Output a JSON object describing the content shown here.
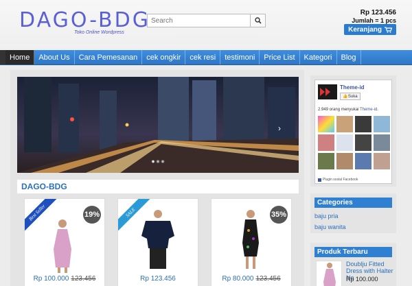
{
  "header": {
    "logo": "DAGO-BDG",
    "tagline": "Toko Online Wordpress",
    "search_placeholder": "Search",
    "cart_total": "Rp 123.456",
    "cart_qty": "Jumlah = 1 pcs",
    "cart_label": "Keranjang"
  },
  "nav": {
    "items": [
      {
        "label": "Home"
      },
      {
        "label": "About Us"
      },
      {
        "label": "Cara Pemesanan"
      },
      {
        "label": "cek ongkir"
      },
      {
        "label": "cek resi"
      },
      {
        "label": "testimoni"
      },
      {
        "label": "Price List"
      },
      {
        "label": "Kategori"
      },
      {
        "label": "Blog"
      }
    ]
  },
  "section": {
    "title": "DAGO-BDG"
  },
  "products": [
    {
      "ribbon": "Best Seller",
      "discount": "19%",
      "price": "Rp 100.000",
      "old_price": "123.456"
    },
    {
      "ribbon": "SALE",
      "discount": "",
      "price": "Rp 123.456",
      "old_price": ""
    },
    {
      "ribbon": "",
      "discount": "35%",
      "price": "Rp 80.000",
      "old_price": "123.456"
    }
  ],
  "facebook": {
    "page_name": "Theme-id",
    "like_label": "Suka",
    "count_prefix": "2.949 orang menyukai",
    "count_link": "Theme-id",
    "count_suffix": ".",
    "plugin_label": "Plugin sosial Facebook"
  },
  "categories": {
    "title": "Categories",
    "items": [
      {
        "label": "baju pria"
      },
      {
        "label": "baju wanita"
      }
    ]
  },
  "new_products": {
    "title": "Produk Terbaru",
    "item_name": "Doublju Fitted Dress with Halter Ne",
    "item_price": "Rp 100.000"
  },
  "colors": {
    "accent": "#2f7fd3",
    "logo": "#5a5fd8",
    "nav_active": "#2a2a2a"
  }
}
